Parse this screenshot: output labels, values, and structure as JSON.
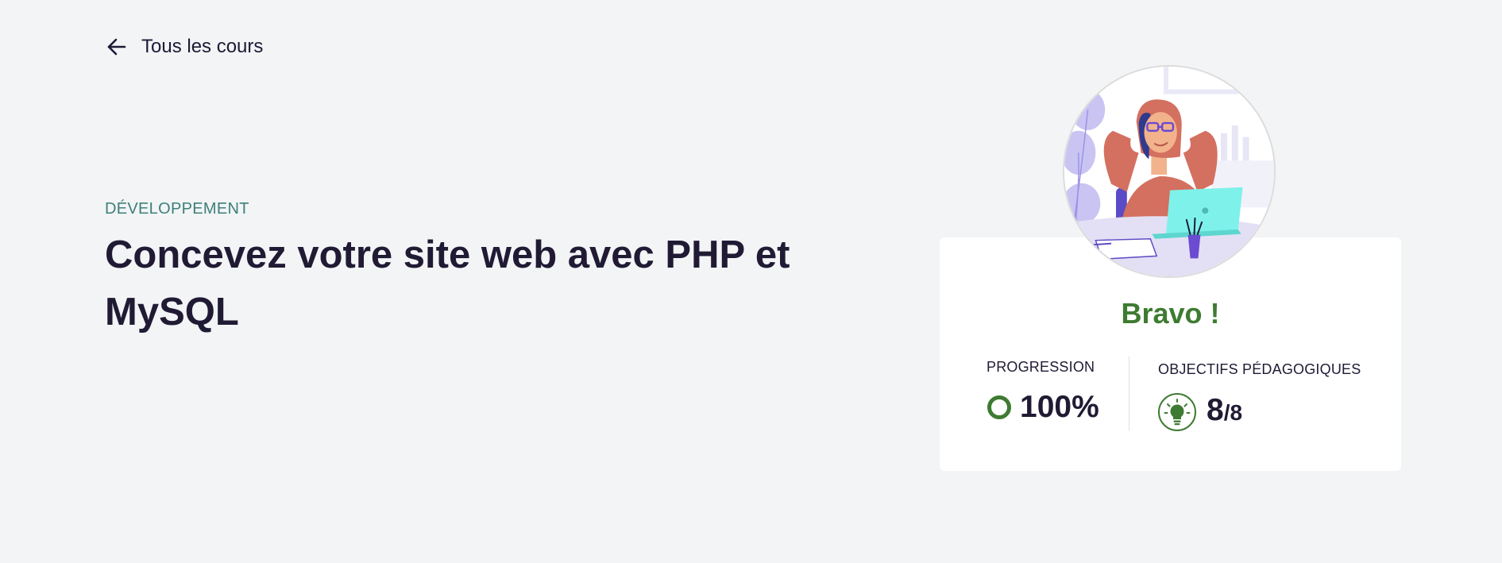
{
  "nav": {
    "back_label": "Tous les cours",
    "back_icon": "arrow-left-icon"
  },
  "course": {
    "category": "DÉVELOPPEMENT",
    "title": "Concevez votre site web avec PHP et MySQL"
  },
  "completion_card": {
    "illustration": "person-relaxing-at-laptop",
    "headline": "Bravo !",
    "progress": {
      "label": "PROGRESSION",
      "value_text": "100%",
      "fraction": 1.0,
      "icon": "progress-ring-icon"
    },
    "objectives": {
      "label": "OBJECTIFS PÉDAGOGIQUES",
      "done": "8",
      "separator": "/",
      "total": "8",
      "icon": "lightbulb-icon"
    }
  },
  "colors": {
    "background": "#f2f4f5",
    "text": "#211a34",
    "category": "#3d7f7a",
    "success": "#3e7b32",
    "card": "#ffffff"
  }
}
